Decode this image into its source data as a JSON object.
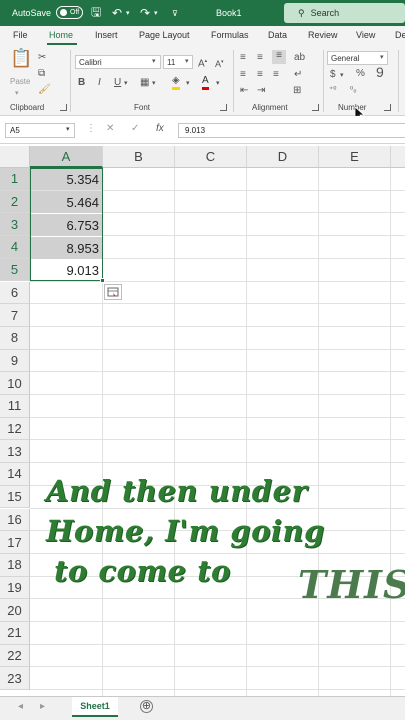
{
  "titlebar": {
    "autosave_label": "AutoSave",
    "toggle_state": "Off",
    "book_title": "Book1",
    "search_placeholder": "Search"
  },
  "tabs": [
    "File",
    "Home",
    "Insert",
    "Page Layout",
    "Formulas",
    "Data",
    "Review",
    "View",
    "De"
  ],
  "active_tab": "Home",
  "ribbon": {
    "font_name": "Calibri",
    "font_size": "11",
    "number_format": "General",
    "groups": {
      "clipboard": "Clipboard",
      "font": "Font",
      "alignment": "Alignment",
      "number": "Number"
    },
    "paste_label": "Paste"
  },
  "formula_bar": {
    "name_box": "A5",
    "formula_value": "9.013"
  },
  "grid": {
    "columns": [
      "A",
      "B",
      "C",
      "D",
      "E"
    ],
    "rows": [
      "1",
      "2",
      "3",
      "4",
      "5",
      "6",
      "7",
      "8",
      "9",
      "10",
      "11",
      "12",
      "13",
      "14",
      "15",
      "16",
      "17",
      "18",
      "19",
      "20",
      "21",
      "22",
      "23"
    ],
    "cells_col_a": [
      "5.354",
      "5.464",
      "6.753",
      "8.953",
      "9.013"
    ]
  },
  "caption": {
    "line1": "And then under",
    "line2": "Home, I'm going",
    "line3": "to come to",
    "highlight": "THIS"
  },
  "status": {
    "sheet_name": "Sheet1",
    "add_symbol": "⊕"
  },
  "colors": {
    "excel_green": "#217346",
    "caption_green": "#2e7d32"
  }
}
